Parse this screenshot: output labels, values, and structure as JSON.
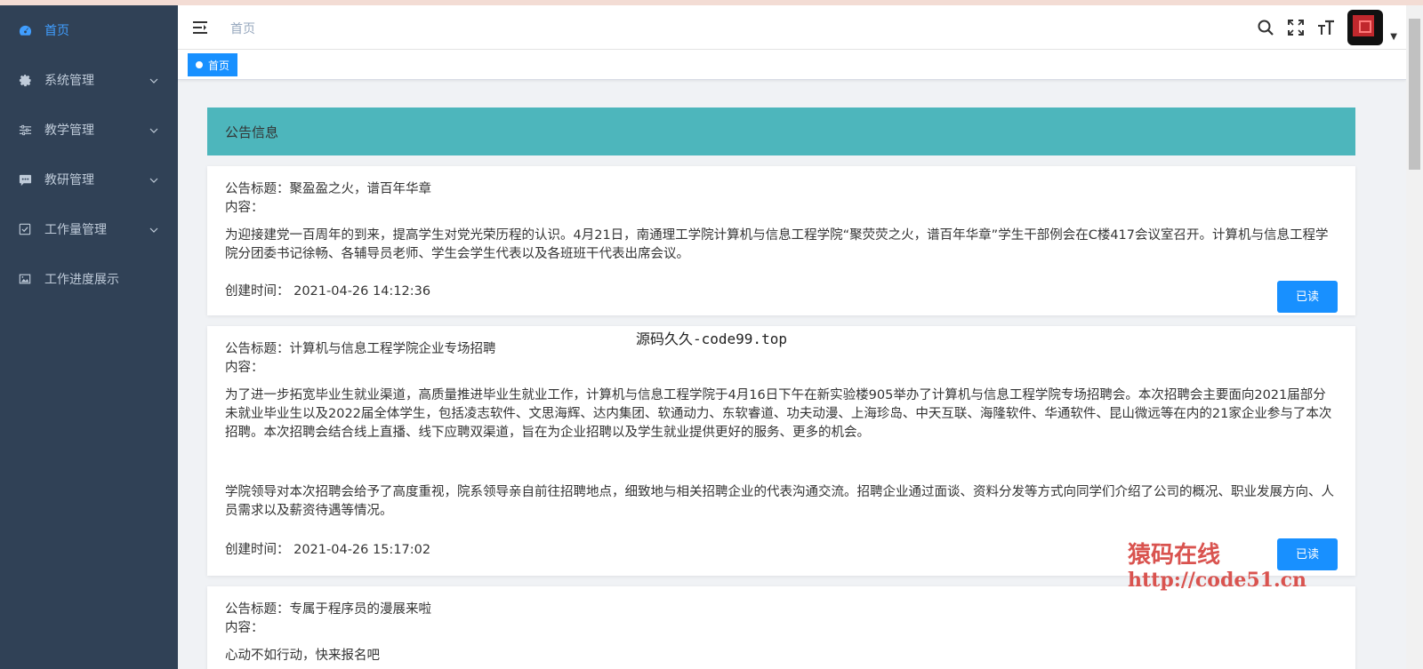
{
  "sidebar": {
    "items": [
      {
        "label": "首页",
        "icon": "dashboard-icon",
        "active": true
      },
      {
        "label": "系统管理",
        "icon": "gear-icon"
      },
      {
        "label": "教学管理",
        "icon": "sliders-icon"
      },
      {
        "label": "教研管理",
        "icon": "chat-icon"
      },
      {
        "label": "工作量管理",
        "icon": "checkbox-icon"
      },
      {
        "label": "工作进度展示",
        "icon": "image-icon"
      }
    ],
    "colors": {
      "bg": "#304156",
      "text": "#bfcbd9",
      "active": "#409eff"
    }
  },
  "navbar": {
    "breadcrumb": "首页",
    "icons": [
      "search-icon",
      "fullscreen-icon",
      "font-size-icon",
      "avatar",
      "caret-down-icon"
    ]
  },
  "tags": {
    "active_tag": "首页"
  },
  "notice": {
    "header": "公告信息",
    "header_color": "#4db6bc",
    "button_color": "#1890ff",
    "cards": [
      {
        "title": "公告标题：聚盈盈之火，谱百年华章",
        "content_label": "内容：",
        "paragraphs": [
          "为迎接建党一百周年的到来，提高学生对党光荣历程的认识。4月21日，南通理工学院计算机与信息工程学院“聚荧荧之火，谱百年华章”学生干部例会在C楼417会议室召开。计算机与信息工程学院分团委书记徐畅、各辅导员老师、学生会学生代表以及各班班干代表出席会议。"
        ],
        "time_label": "创建时间：",
        "time": "2021-04-26 14:12:36",
        "button": "已读"
      },
      {
        "title": "公告标题：计算机与信息工程学院企业专场招聘",
        "content_label": "内容：",
        "paragraphs": [
          "为了进一步拓宽毕业生就业渠道，高质量推进毕业生就业工作，计算机与信息工程学院于4月16日下午在新实验楼905举办了计算机与信息工程学院专场招聘会。本次招聘会主要面向2021届部分未就业毕业生以及2022届全体学生，包括凌志软件、文思海辉、达内集团、软通动力、东软睿道、功夫动漫、上海珍岛、中天互联、海隆软件、华通软件、昆山微远等在内的21家企业参与了本次招聘。本次招聘会结合线上直播、线下应聘双渠道，旨在为企业招聘以及学生就业提供更好的服务、更多的机会。",
          "学院领导对本次招聘会给予了高度重视，院系领导亲自前往招聘地点，细致地与相关招聘企业的代表沟通交流。招聘企业通过面谈、资料分发等方式向同学们介绍了公司的概况、职业发展方向、人员需求以及薪资待遇等情况。"
        ],
        "time_label": "创建时间：",
        "time": "2021-04-26 15:17:02",
        "button": "已读"
      },
      {
        "title": "公告标题：专属于程序员的漫展来啦",
        "content_label": "内容：",
        "paragraphs": [
          "心动不如行动，快来报名吧"
        ]
      }
    ]
  },
  "watermarks": {
    "center": "源码久久-code99.top",
    "right_title": "猿码在线",
    "right_url": "http://code51.cn"
  }
}
